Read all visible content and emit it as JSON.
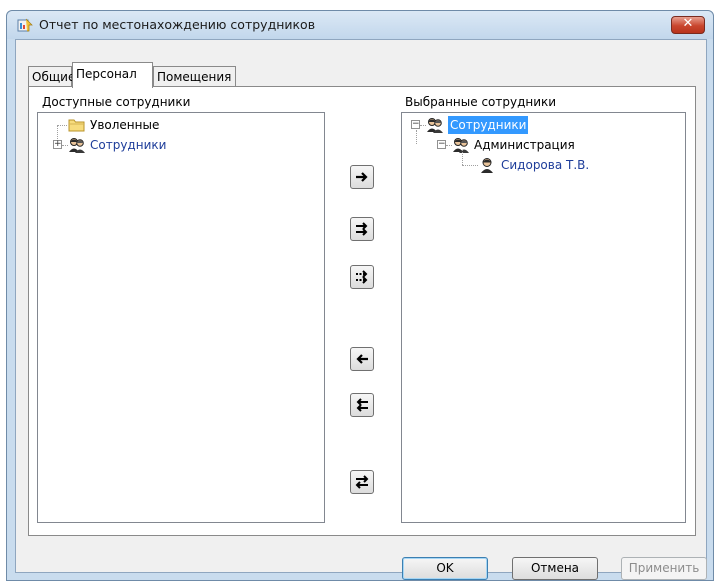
{
  "window": {
    "title": "Отчет по местонахождению сотрудников",
    "close_label": "✕"
  },
  "tabs": [
    {
      "label": "Общие",
      "active": false
    },
    {
      "label": "Персонал",
      "active": true
    },
    {
      "label": "Помещения",
      "active": false
    }
  ],
  "available": {
    "label": "Доступные сотрудники",
    "items": [
      {
        "label": "Уволенные",
        "icon": "folder-icon",
        "expandable": false
      },
      {
        "label": "Сотрудники",
        "icon": "people-group-icon",
        "expandable": true,
        "expander": "+"
      }
    ]
  },
  "selected": {
    "label": "Выбранные сотрудники",
    "items": [
      {
        "label": "Сотрудники",
        "icon": "people-group-icon",
        "expander": "−",
        "selected": true
      },
      {
        "label": "Администрация",
        "icon": "people-group-icon",
        "expander": "−"
      },
      {
        "label": "Сидорова Т.В.",
        "icon": "person-icon"
      }
    ]
  },
  "move_buttons": [
    {
      "name": "add-selected-button",
      "icon": "arrow-right-icon"
    },
    {
      "name": "add-all-button",
      "icon": "double-arrow-right-icon"
    },
    {
      "name": "add-filtered-button",
      "icon": "dotted-double-arrow-right-icon"
    },
    {
      "name": "remove-selected-button",
      "icon": "arrow-left-icon"
    },
    {
      "name": "remove-all-button",
      "icon": "double-arrow-left-icon"
    },
    {
      "name": "swap-button",
      "icon": "swap-arrows-icon"
    }
  ],
  "buttons": {
    "ok": "OK",
    "cancel": "Отмена",
    "apply": "Применить"
  },
  "colors": {
    "selection": "#3399ff",
    "tree_link_text": "#1e3d9a",
    "frame": "#c9dcee"
  }
}
